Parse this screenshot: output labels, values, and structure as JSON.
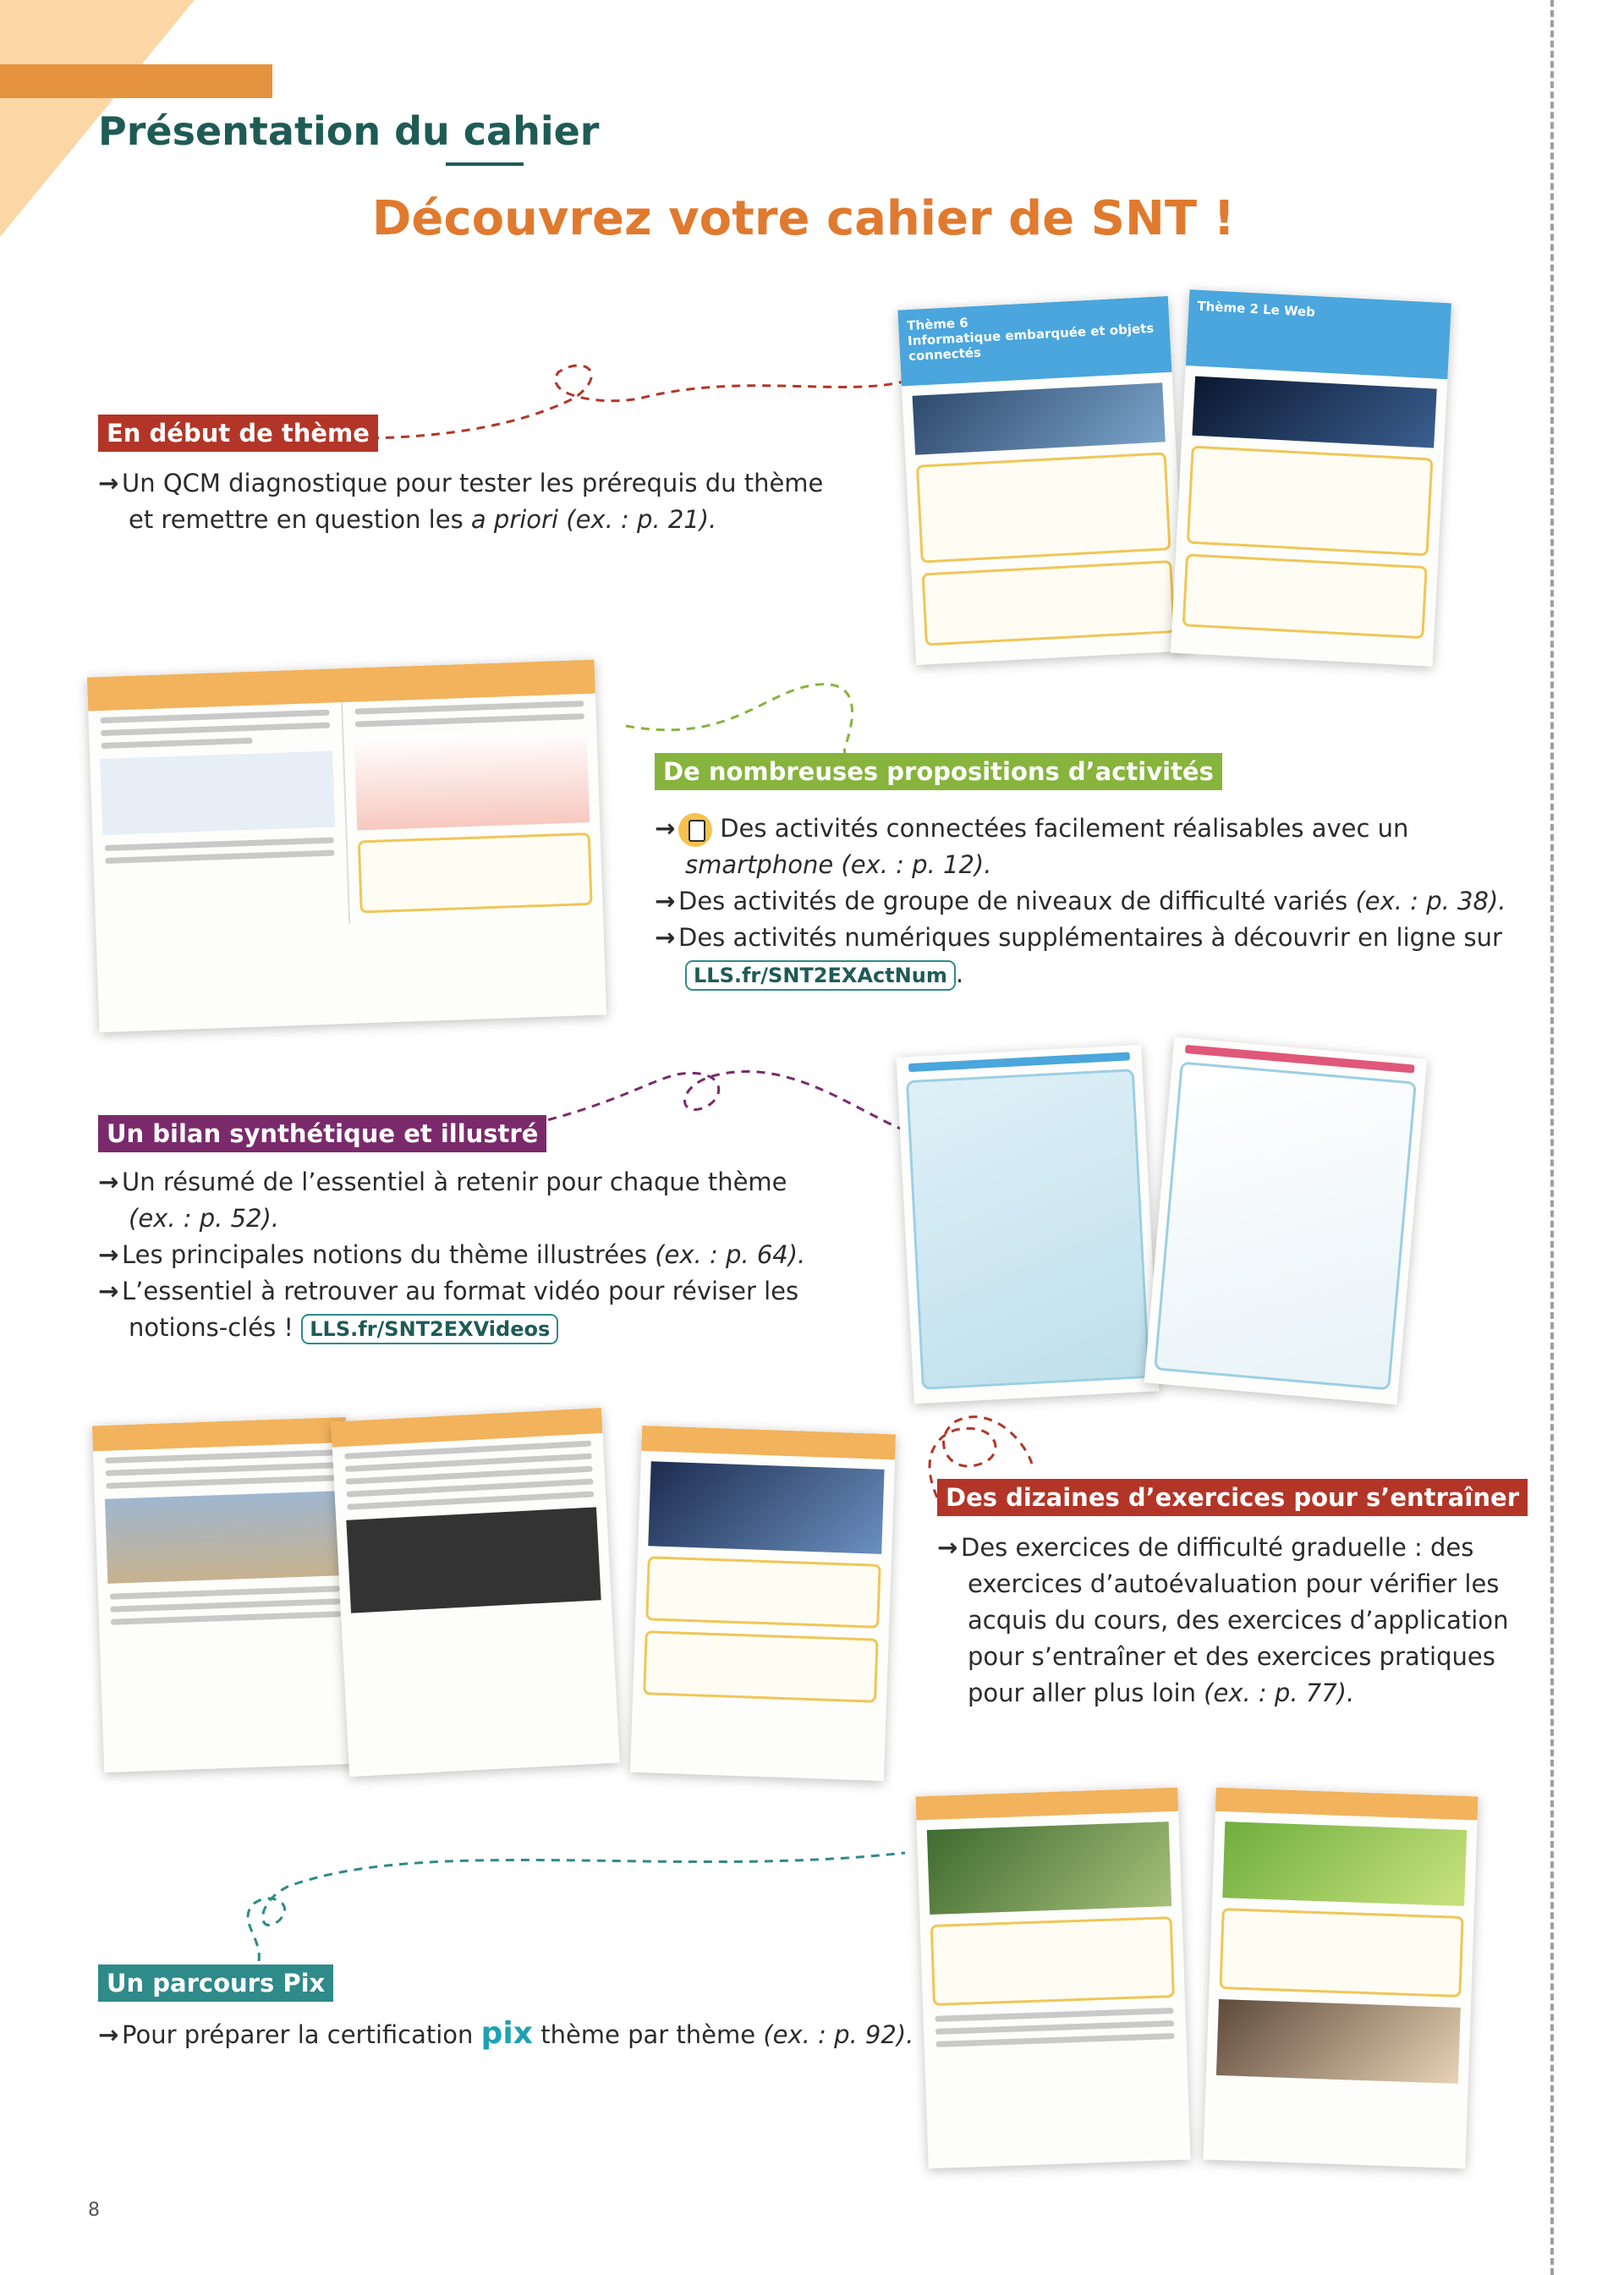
{
  "header": {
    "section_title": "Présentation du cahier",
    "main_title": "Découvrez votre cahier de SNT !"
  },
  "sections": {
    "debut": {
      "label": "En début de thème",
      "line1": "Un QCM diagnostique pour tester les prérequis du thème",
      "line2a": "et remettre en question les ",
      "line2b": "a priori",
      "line2c": " (ex. : p. 21)."
    },
    "activites": {
      "label": "De nombreuses propositions d’activités",
      "b1": "Des activités connectées facilement réalisables avec un",
      "b1_cont_italic": "smartphone",
      "b1_cont": " (ex. : p. 12).",
      "b2a": "Des activités de groupe de niveaux de difficulté variés ",
      "b2b": "(ex. : p. 38).",
      "b3": "Des activités numériques supplémentaires à découvrir en ligne sur",
      "link": "LLS.fr/SNT2EXActNum"
    },
    "bilan": {
      "label": "Un bilan synthétique et illustré",
      "b1": "Un résumé de l’essentiel à retenir pour chaque thème",
      "b1_cont": "(ex. : p. 52).",
      "b2a": "Les principales notions du thème illustrées ",
      "b2b": "(ex. : p. 64).",
      "b3": "L’essentiel à retrouver au format vidéo pour réviser les",
      "b3_cont": "notions-clés ! ",
      "link": "LLS.fr/SNT2EXVideos"
    },
    "exercices": {
      "label": "Des dizaines d’exercices pour s’entraîner",
      "l1": "Des exercices de difficulté graduelle : des",
      "l2": "exercices d’autoévaluation pour vérifier les",
      "l3": "acquis du cours, des exercices d’application",
      "l4": "pour s’entraîner et des exercices pratiques",
      "l5a": "pour aller plus loin ",
      "l5b": "(ex. : p. 77)."
    },
    "pix": {
      "label": "Un parcours Pix",
      "a": "Pour préparer la certification ",
      "logo": "pix",
      "b": " thème par thème ",
      "c": "(ex. : p. 92)."
    }
  },
  "thumbnails": {
    "theme6_title": "Informatique embarquée et objets connectés",
    "theme6_tag": "Thème 6",
    "theme2_title": "Le Web",
    "theme2_tag": "Thème 2"
  },
  "page_number": "8",
  "colors": {
    "title_teal": "#1f5b55",
    "main_orange": "#e07a2e",
    "label_red": "#b33527",
    "label_green": "#86b43c",
    "label_purple": "#7a2a6b",
    "label_teal": "#2f8a8a"
  }
}
